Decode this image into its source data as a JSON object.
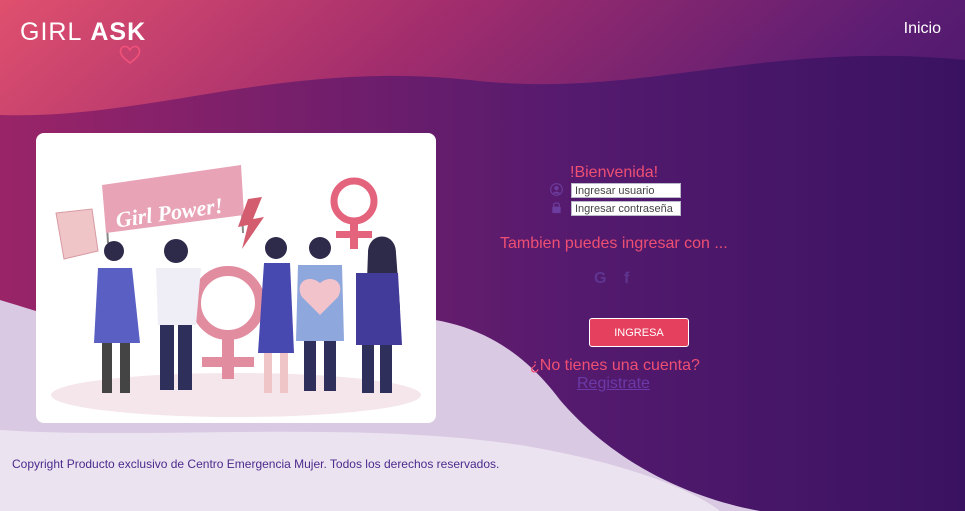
{
  "brand": {
    "logo_light": "GIRL",
    "logo_bold": "ASK"
  },
  "nav": {
    "inicio": "Inicio"
  },
  "hero": {
    "banner_text": "Girl Power!"
  },
  "login": {
    "welcome": "!Bienvenida!",
    "username_placeholder": "Ingresar usuario",
    "password_placeholder": "Ingresar contraseña",
    "alt_text": "Tambien puedes ingresar con ...",
    "google_label": "G",
    "facebook_label": "f",
    "submit_label": "INGRESA",
    "no_account": "¿No tienes una cuenta?",
    "register_link": "Registrate"
  },
  "footer": {
    "copyright": "Copyright Producto exclusivo de Centro Emergencia Mujer. Todos los derechos reservados."
  },
  "colors": {
    "accent": "#e5415f",
    "pink_text": "#ee4f72",
    "purple_dark": "#3d1466"
  },
  "icons": [
    "heart-icon",
    "user-icon",
    "lock-icon",
    "google-icon",
    "facebook-icon"
  ]
}
